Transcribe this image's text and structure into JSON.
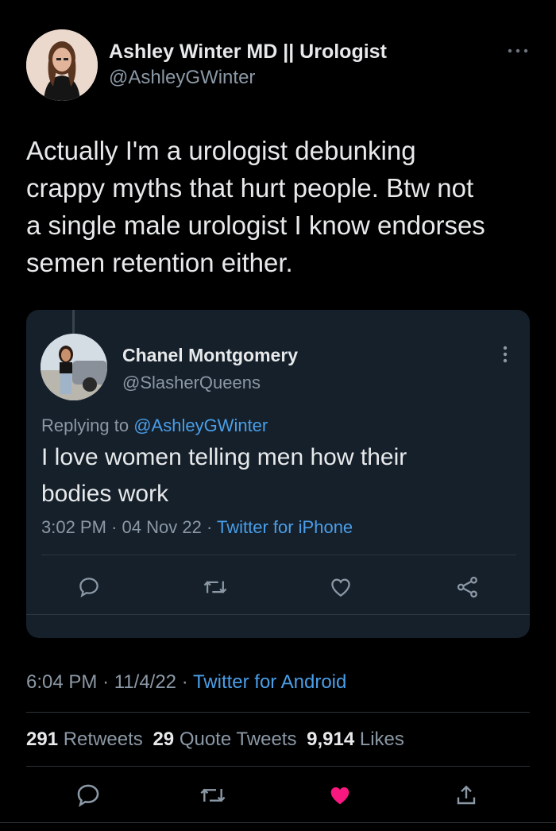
{
  "author": {
    "name": "Ashley Winter MD || Urologist",
    "handle": "@AshleyGWinter"
  },
  "tweet": {
    "text_lines": [
      "Actually I'm a urologist debunking",
      "crappy myths that hurt people. Btw not",
      "a single male urologist I know endorses",
      "semen retention either."
    ],
    "time": "6:04 PM",
    "date": "11/4/22",
    "source": "Twitter for Android"
  },
  "quoted": {
    "name": "Chanel Montgomery",
    "handle": "@SlasherQueens",
    "replying_prefix": "Replying to",
    "replying_handle": "@AshleyGWinter",
    "text_lines": [
      "I love women telling men how their",
      "bodies work"
    ],
    "time": "3:02 PM",
    "date": "04 Nov 22",
    "source": "Twitter for iPhone"
  },
  "stats": {
    "retweets_count": "291",
    "retweets_label": "Retweets",
    "quotes_count": "29",
    "quotes_label": "Quote Tweets",
    "likes_count": "9,914",
    "likes_label": "Likes"
  },
  "colors": {
    "background": "#000000",
    "card": "#15202b",
    "link": "#4a9ee8",
    "muted": "#8b98a5",
    "like_active": "#f91880"
  },
  "icons": {
    "more": "more-horizontal-icon",
    "reply": "reply-icon",
    "retweet": "retweet-icon",
    "like": "heart-icon",
    "share": "share-icon"
  }
}
